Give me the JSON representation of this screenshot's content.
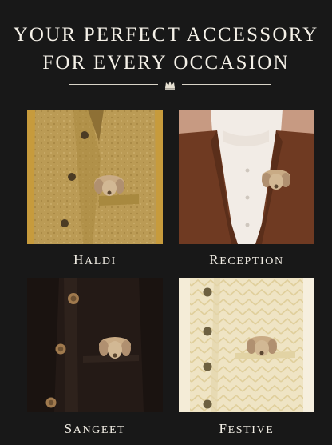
{
  "headline": {
    "line1": "Your Perfect Accessory",
    "line2": "For Every Occasion"
  },
  "divider_icon": "crown-icon",
  "occasions": [
    {
      "label": "Haldi",
      "image": "mustard-nehru-jacket-with-dog-brooch",
      "accent": "#b8974f"
    },
    {
      "label": "Reception",
      "image": "brown-suit-with-dog-brooch",
      "accent": "#6f3a22"
    },
    {
      "label": "Sangeet",
      "image": "black-bandhgala-with-dog-brooch",
      "accent": "#2a1d18"
    },
    {
      "label": "Festive",
      "image": "cream-chevron-jacket-with-dog-brooch",
      "accent": "#ece0bb"
    }
  ],
  "colors": {
    "background": "#181818",
    "text": "#f5f1e8",
    "brooch": "#c9ab85"
  }
}
